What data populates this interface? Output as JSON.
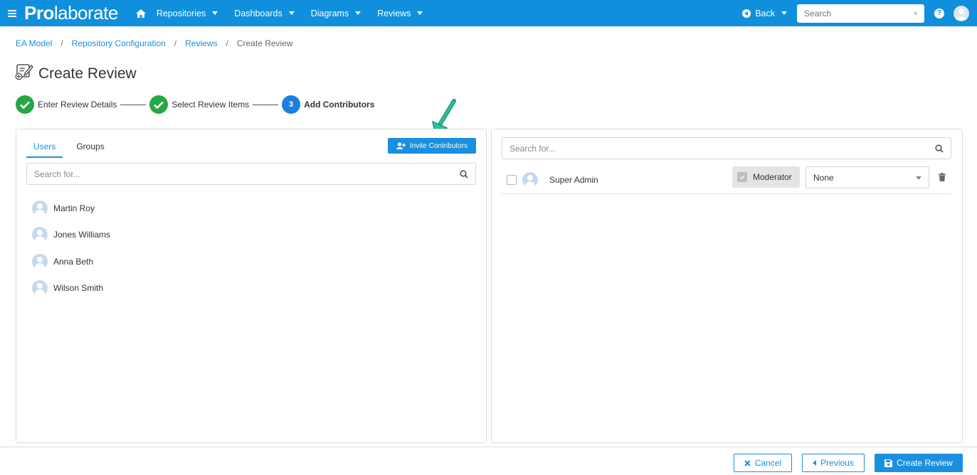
{
  "navbar": {
    "brand_bold": "Pro",
    "brand_rest": "laborate",
    "items": [
      {
        "label": "Repositories"
      },
      {
        "label": "Dashboards"
      },
      {
        "label": "Diagrams"
      },
      {
        "label": "Reviews"
      }
    ],
    "back_label": "Back",
    "search_placeholder": "Search",
    "accent_color": "#0f8fdc"
  },
  "breadcrumb": {
    "items": [
      "EA Model",
      "Repository Configuration",
      "Reviews"
    ],
    "current": "Create Review"
  },
  "page": {
    "title": "Create Review"
  },
  "stepper": {
    "steps": [
      {
        "label": "Enter Review Details",
        "status": "done"
      },
      {
        "label": "Select Review Items",
        "status": "done"
      },
      {
        "number": "3",
        "label": "Add Contributors",
        "status": "active"
      }
    ]
  },
  "left_panel": {
    "tabs": [
      {
        "label": "Users",
        "active": true
      },
      {
        "label": "Groups",
        "active": false
      }
    ],
    "invite_label": "Invite Contributors",
    "search_placeholder": "Search for...",
    "users": [
      {
        "name": "Martin Roy"
      },
      {
        "name": "Jones Williams"
      },
      {
        "name": "Anna Beth"
      },
      {
        "name": "Wilson Smith"
      }
    ]
  },
  "right_panel": {
    "search_placeholder": "Search for...",
    "contributors": [
      {
        "name": "Super Admin",
        "moderator_label": "Moderator",
        "role": "None"
      }
    ]
  },
  "footer": {
    "cancel_label": "Cancel",
    "previous_label": "Previous",
    "create_label": "Create Review"
  }
}
